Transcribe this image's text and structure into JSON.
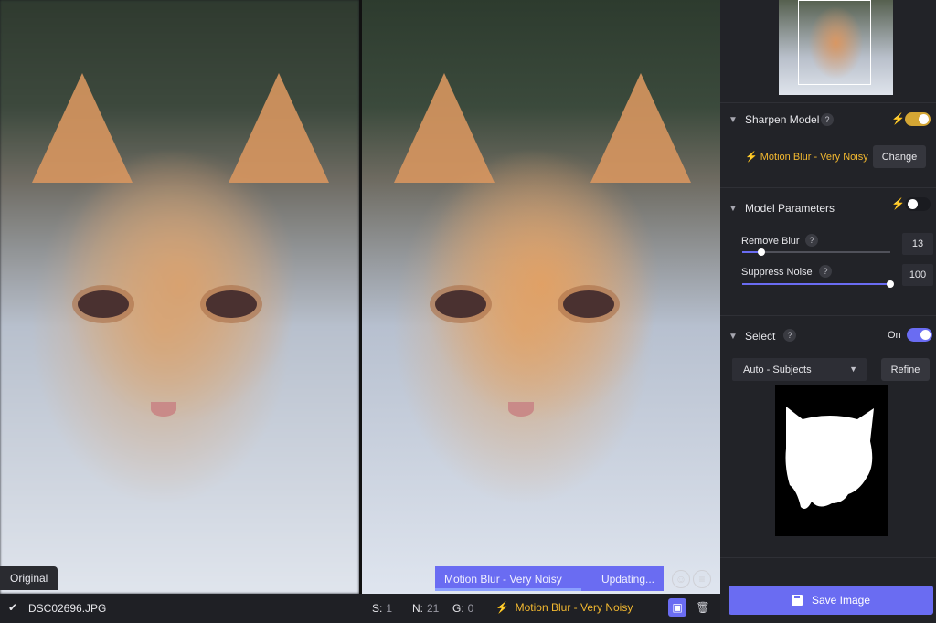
{
  "viewer": {
    "original_label": "Original",
    "status_model": "Motion Blur - Very Noisy",
    "status_state": "Updating...",
    "progress": 0.64
  },
  "bottombar": {
    "filename": "DSC02696.JPG",
    "stats": [
      {
        "label": "S:",
        "value": "1"
      },
      {
        "label": "N:",
        "value": "21"
      },
      {
        "label": "G:",
        "value": "0"
      }
    ],
    "model": "Motion Blur - Very Noisy"
  },
  "panel": {
    "sharpen": {
      "title": "Sharpen Model",
      "help": "?",
      "enabled": true,
      "model_name": "Motion Blur - Very Noisy",
      "change_label": "Change"
    },
    "params": {
      "title": "Model Parameters",
      "help": "?",
      "enabled": false,
      "remove_blur": {
        "label": "Remove Blur",
        "help": "?",
        "value": "13",
        "fraction": 0.13
      },
      "suppress_noise": {
        "label": "Suppress Noise",
        "help": "?",
        "value": "100",
        "fraction": 1.0
      }
    },
    "select": {
      "title": "Select",
      "help": "?",
      "state_label": "On",
      "dropdown": "Auto - Subjects",
      "refine_label": "Refine"
    },
    "save_label": "Save Image"
  },
  "colors": {
    "accent": "#6a6cf2",
    "model_yellow": "#f2b830",
    "toggle_on_yellow": "#d4a634",
    "panel_bg": "#222328"
  },
  "icons": {
    "check": "check-icon",
    "bolt": "lightning-bolt-icon",
    "chevron": "chevron-down-icon",
    "save": "floppy-disk-icon",
    "trash": "trash-icon",
    "compare": "compare-view-icon",
    "smile": "smile-face-icon",
    "neutral": "neutral-face-icon"
  }
}
